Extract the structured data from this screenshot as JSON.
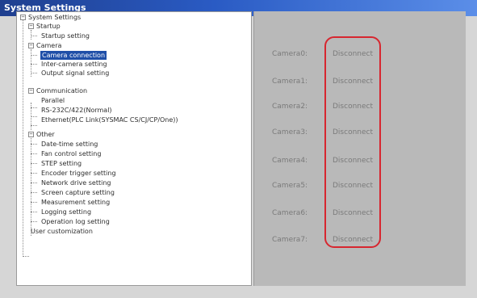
{
  "window": {
    "title": "System Settings"
  },
  "tree": {
    "root": "System Settings",
    "startup": {
      "label": "Startup",
      "children": [
        "Startup setting"
      ]
    },
    "camera": {
      "label": "Camera",
      "children": [
        "Camera connection",
        "Inter-camera setting",
        "Output signal setting"
      ]
    },
    "communication": {
      "label": "Communication",
      "children": [
        "Parallel",
        "RS-232C/422(Normal)",
        "Ethernet(PLC Link(SYSMAC CS/CJ/CP/One))"
      ]
    },
    "other": {
      "label": "Other",
      "children": [
        "Date-time setting",
        "Fan control setting",
        "STEP setting",
        "Encoder trigger setting",
        "Network drive setting",
        "Screen capture setting",
        "Measurement setting",
        "Logging setting",
        "Operation log setting"
      ]
    },
    "user_customization": "User customization"
  },
  "cameras": [
    {
      "label": "Camera0:",
      "status": "Disconnect"
    },
    {
      "label": "Camera1:",
      "status": "Disconnect"
    },
    {
      "label": "Camera2:",
      "status": "Disconnect"
    },
    {
      "label": "Camera3:",
      "status": "Disconnect"
    },
    {
      "label": "Camera4:",
      "status": "Disconnect"
    },
    {
      "label": "Camera5:",
      "status": "Disconnect"
    },
    {
      "label": "Camera6:",
      "status": "Disconnect"
    },
    {
      "label": "Camera7:",
      "status": "Disconnect"
    }
  ],
  "colors": {
    "titlebar": "#1f3f8f",
    "selection": "#1f4fa8",
    "highlight_ring": "#d7262f",
    "panel_bg": "#b9b9b9"
  }
}
